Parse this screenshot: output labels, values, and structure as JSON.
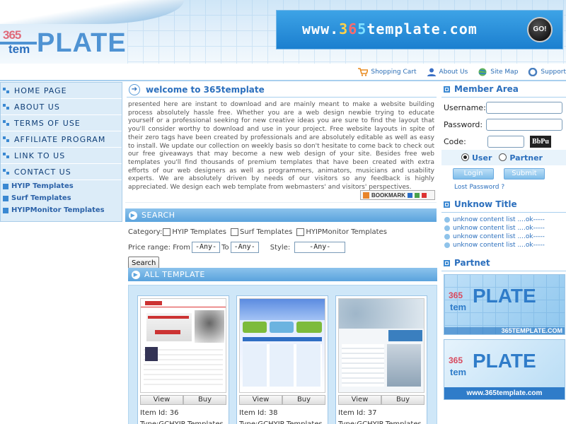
{
  "header": {
    "logo": {
      "digits": "365",
      "tem": "tem",
      "plate": "PLATE"
    },
    "banner": {
      "prefix": "www.",
      "d1": "3",
      "d2": "6",
      "d3": "5",
      "suffix": "template.com",
      "go": "GO!"
    }
  },
  "topnav": {
    "items": [
      {
        "label": "Shopping Cart",
        "icon": "shopping-cart-icon"
      },
      {
        "label": "About Us",
        "icon": "user-icon"
      },
      {
        "label": "Site Map",
        "icon": "globe-icon"
      },
      {
        "label": "Support",
        "icon": "support-icon"
      }
    ]
  },
  "sidebar": {
    "items": [
      "HOME PAGE",
      "ABOUT US",
      "TERMS OF USE",
      "AFFILIATE PROGRAM",
      "LINK TO US",
      "CONTACT US"
    ],
    "subitems": [
      "HYIP Templates",
      "Surf Templates",
      "HYIPMonitor Templates"
    ]
  },
  "welcome": {
    "title": "welcome to 365template",
    "text": "presented here are instant to download and are mainly meant to make a website building process absolutely hassle free. Whether you are a web design newbie trying to educate yourself or a professional seeking for new creative ideas you are sure to find the layout that you'll consider worthy to download and use in your project. Free website layouts in spite of their zero tags have been created by professionals and are absolutely editable as well as easy to install. We update our collection on weekly basis so don't hesitate to come back to check out our free giveaways that may become a new web design of your site. Besides free web templates you'll find thousands of premium templates that have been created with extra efforts of our web designers as well as programmers, animators, musicians and usability experts. We are absolutely driven by needs of our visitors so any feedback is highly appreciated. We design each web template from webmasters' and visitors' perspectives.",
    "bookmark": "BOOKMARK"
  },
  "search": {
    "title": "SEARCH",
    "category_label": "Category:",
    "categories": [
      "HYIP Templates",
      "Surf Templates",
      "HYIPMonitor Templates"
    ],
    "price_label": "Price range: From",
    "from": "-Any-",
    "to_label": "To",
    "to": "-Any-",
    "style_label": "Style:",
    "style": "-Any-",
    "button": "Search"
  },
  "all_template": {
    "title": "ALL TEMPLATE",
    "cards": [
      {
        "view": "View",
        "buy": "Buy",
        "id": "Item Id: 36",
        "type": "Type:GCHYIP Templates"
      },
      {
        "view": "View",
        "buy": "Buy",
        "id": "Item Id: 38",
        "type": "Type:GCHYIP Templates"
      },
      {
        "view": "View",
        "buy": "Buy",
        "id": "Item Id: 37",
        "type": "Type:GCHYIP Templates"
      }
    ]
  },
  "member": {
    "title": "Member Area",
    "username": "Username:",
    "password": "Password:",
    "code": "Code:",
    "captcha": "BbPu",
    "user": "User",
    "partner": "Partner",
    "login": "Login",
    "submit": "Submit",
    "lost": "Lost Password ?"
  },
  "unknow": {
    "title": "Unknow Title",
    "items": [
      "unknow content list ....ok-----",
      "unknow content list ....ok-----",
      "unknow content list ....ok-----",
      "unknow content list ....ok-----"
    ]
  },
  "partnet": {
    "title": "Partnet",
    "banners": [
      {
        "footer": "365TEMPLATE.COM"
      },
      {
        "footer": "www.365template.com"
      }
    ]
  },
  "colors": {
    "accent": "#2b6fbd",
    "bar": "#5aa3dd",
    "nav_bg": "#dcecf8"
  }
}
